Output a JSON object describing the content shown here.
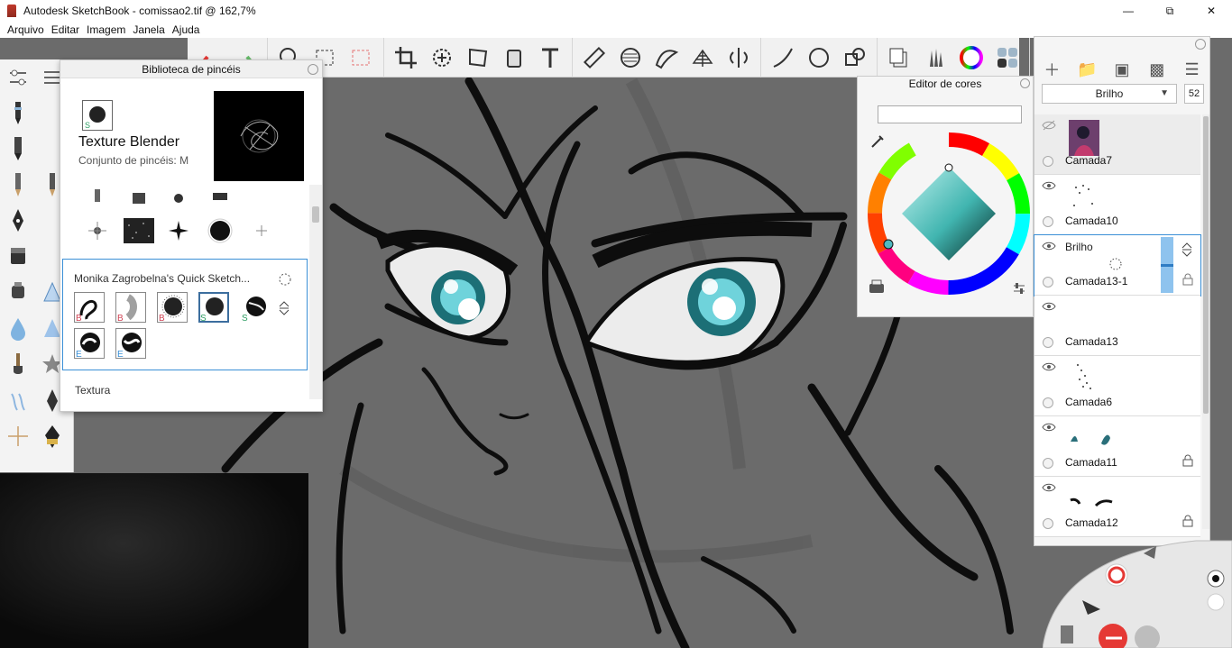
{
  "window": {
    "title": "Autodesk SketchBook - comissao2.tif @ 162,7%",
    "minimize_icon": "minimize-icon",
    "maximize_icon": "restore-icon",
    "close_icon": "close-icon"
  },
  "menu": {
    "items": [
      "Arquivo",
      "Editar",
      "Imagem",
      "Janela",
      "Ajuda"
    ]
  },
  "toolbar": {
    "tools": [
      "undo",
      "redo",
      "zoom",
      "select-rect",
      "select-lasso",
      "crop",
      "transform",
      "distort",
      "bucket-fill",
      "text",
      "ruler",
      "ellipse-guide",
      "french-curve",
      "perspective",
      "symmetry",
      "line",
      "ellipse",
      "shape",
      "copy-paste",
      "brush-library",
      "color-wheel",
      "brush-properties"
    ]
  },
  "brush_library": {
    "title": "Biblioteca de pincéis",
    "current_brush_name": "Texture Blender",
    "current_brush_set": "Conjunto de pincéis: M",
    "set_title": "Monika Zagrobelna's Quick Sketch...",
    "set_brush_badges": [
      "B",
      "B",
      "B",
      "S",
      "S",
      "E",
      "E"
    ],
    "next_section": "Textura"
  },
  "color_editor": {
    "title": "Editor de cores",
    "hex_value": ""
  },
  "layers": {
    "blend_mode": "Brilho",
    "opacity": "52",
    "items": [
      {
        "name": "Camada7",
        "visible": false,
        "locked": false
      },
      {
        "name": "Camada10",
        "visible": true,
        "locked": false
      },
      {
        "name": "Brilho",
        "sub_name": "Camada13-1",
        "visible": true,
        "locked": true,
        "active": true
      },
      {
        "name": "Camada13",
        "visible": true,
        "locked": false
      },
      {
        "name": "Camada6",
        "visible": true,
        "locked": false
      },
      {
        "name": "Camada11",
        "visible": true,
        "locked": true
      },
      {
        "name": "Camada12",
        "visible": true,
        "locked": true
      }
    ]
  },
  "colors": {
    "accent": "#3a8fd6",
    "undo_red": "#e53935",
    "redo_green": "#66bb6a",
    "canvas_gray": "#6e6e6e"
  }
}
